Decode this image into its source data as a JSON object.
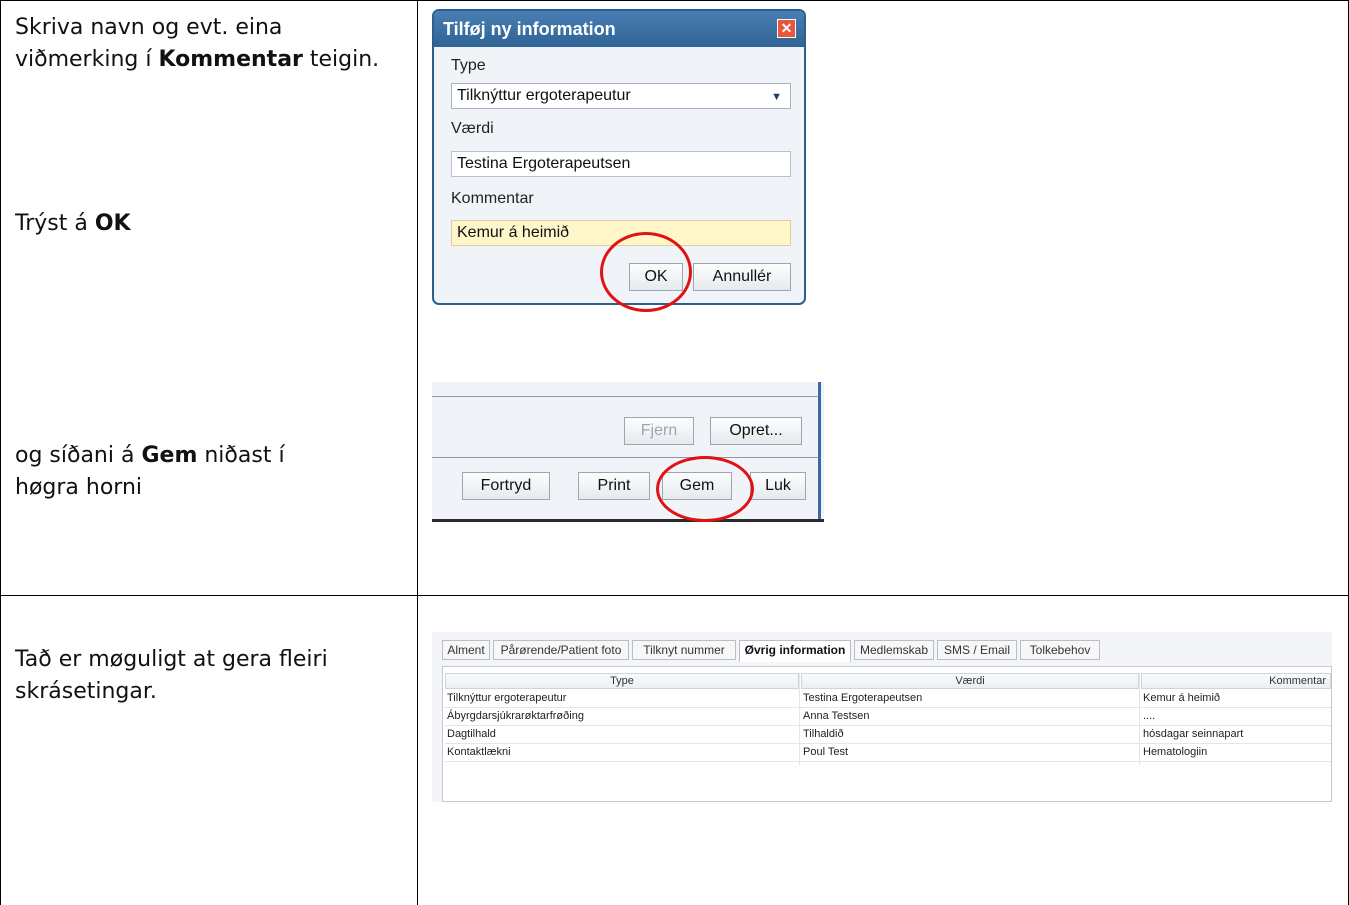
{
  "row1": {
    "step1_pre": "Skriva navn og evt. eina viðmerking í ",
    "step1_bold": "Kommentar",
    "step1_post": " teigin.",
    "step2_pre": "Trýst á ",
    "step2_bold": "OK",
    "step3_pre": "og síðani á ",
    "step3_bold": "Gem",
    "step3_post": " niðast í høgra horni"
  },
  "dialog": {
    "title": "Tilføj ny information",
    "close_glyph": "✕",
    "type_label": "Type",
    "type_value": "Tilknýttur ergoterapeutur",
    "value_label": "Værdi",
    "value_value": "Testina Ergoterapeutsen",
    "comment_label": "Kommentar",
    "comment_value": "Kemur á heimið",
    "ok_label": "OK",
    "cancel_label": "Annullér"
  },
  "toolbar": {
    "remove_label": "Fjern",
    "create_label": "Opret...",
    "undo_label": "Fortryd",
    "print_label": "Print",
    "save_label": "Gem",
    "close_label": "Luk"
  },
  "row2": {
    "text": "Tað er møguligt at gera fleiri skrásetingar."
  },
  "tabs": [
    "Alment",
    "Pårørende/Patient foto",
    "Tilknyt nummer",
    "Øvrig information",
    "Medlemskab",
    "SMS / Email",
    "Tolkebehov"
  ],
  "table": {
    "headers": [
      "Type",
      "Værdi",
      "Kommentar"
    ],
    "rows": [
      [
        "Tilknýttur ergoterapeutur",
        "Testina Ergoterapeutsen",
        "Kemur á heimið"
      ],
      [
        "Ábyrgdarsjúkrarøktarfrøðing",
        "Anna Testsen",
        "...."
      ],
      [
        "Dagtilhald",
        "Tilhaldið",
        "hósdagar seinnapart"
      ],
      [
        "Kontaktlækni",
        "Poul Test",
        "Hematologiin"
      ]
    ]
  },
  "colors": {
    "accent": "#2f6396",
    "highlight": "#e11212",
    "comment_bg": "#fff7c9"
  }
}
